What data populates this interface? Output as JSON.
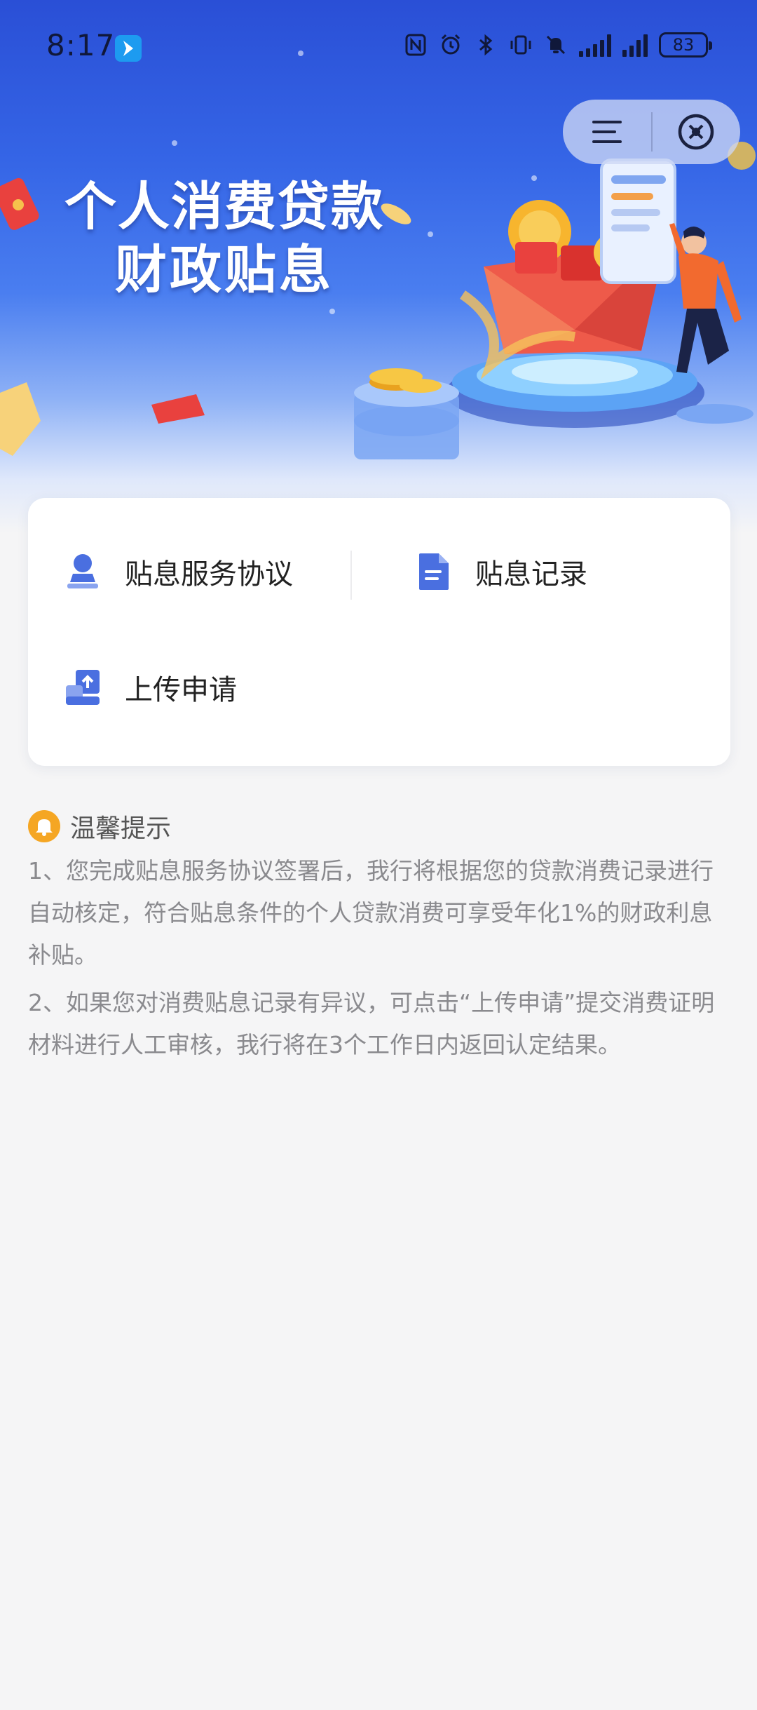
{
  "status_bar": {
    "time": "8:17",
    "battery": "83",
    "icons": [
      "nfc-icon",
      "alarm-icon",
      "bluetooth-icon",
      "vibrate-icon",
      "mute-icon",
      "signal-icon",
      "signal-icon",
      "battery-icon"
    ]
  },
  "capsule": {
    "menu_icon": "menu-icon",
    "close_icon": "close-circle-icon"
  },
  "banner": {
    "title_line1": "个人消费贷款",
    "title_line2": "财政贴息"
  },
  "menu": {
    "items": [
      {
        "label": "贴息服务协议",
        "icon": "user-stamp-icon"
      },
      {
        "label": "贴息记录",
        "icon": "document-icon"
      },
      {
        "label": "上传申请",
        "icon": "upload-icon"
      }
    ]
  },
  "tips": {
    "title": "温馨提示",
    "icon": "bell-icon",
    "p1": "1、您完成贴息服务协议签署后，我行将根据您的贷款消费记录进行自动核定，符合贴息条件的个人贷款消费可享受年化1%的财政利息补贴。",
    "p2": "2、如果您对消费贴息记录有异议，可点击“上传申请”提交消费证明材料进行人工审核，我行将在3个工作日内返回认定结果。"
  },
  "colors": {
    "banner_top": "#2a4fd6",
    "icon_blue": "#4a6fe0",
    "tip_orange": "#f5a623"
  }
}
